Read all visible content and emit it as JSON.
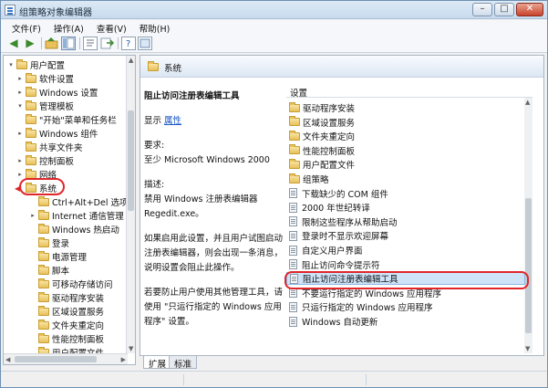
{
  "window": {
    "title": "组策略对象编辑器",
    "controls": {
      "minimize": "–",
      "maximize": "□",
      "close": "✕"
    }
  },
  "menu": [
    "文件(F)",
    "操作(A)",
    "查看(V)",
    "帮助(H)"
  ],
  "toolbar": {
    "icons": [
      "back-arrow-icon",
      "forward-arrow-icon",
      "up-folder-icon",
      "show-tree-icon",
      "properties-icon",
      "export-icon",
      "help-icon",
      "view-icon"
    ]
  },
  "tree": {
    "items": [
      {
        "label": "用户配置",
        "level": 0,
        "expander": "▾"
      },
      {
        "label": "软件设置",
        "level": 1,
        "expander": "▸"
      },
      {
        "label": "Windows 设置",
        "level": 1,
        "expander": "▸"
      },
      {
        "label": "管理模板",
        "level": 1,
        "expander": "▾"
      },
      {
        "label": "\"开始\"菜单和任务栏",
        "level": 2,
        "expander": ""
      },
      {
        "label": "Windows 组件",
        "level": 2,
        "expander": "▸"
      },
      {
        "label": "共享文件夹",
        "level": 2,
        "expander": ""
      },
      {
        "label": "控制面板",
        "level": 2,
        "expander": "▸"
      },
      {
        "label": "网络",
        "level": 2,
        "expander": "▸"
      },
      {
        "label": "系统",
        "level": 2,
        "expander": "▾",
        "selected": true
      },
      {
        "label": "Ctrl+Alt+Del 选项",
        "level": 3,
        "expander": ""
      },
      {
        "label": "Internet 通信管理",
        "level": 3,
        "expander": "▸"
      },
      {
        "label": "Windows 热启动",
        "level": 3,
        "expander": ""
      },
      {
        "label": "登录",
        "level": 3,
        "expander": ""
      },
      {
        "label": "电源管理",
        "level": 3,
        "expander": ""
      },
      {
        "label": "脚本",
        "level": 3,
        "expander": ""
      },
      {
        "label": "可移动存储访问",
        "level": 3,
        "expander": ""
      },
      {
        "label": "驱动程序安装",
        "level": 3,
        "expander": ""
      },
      {
        "label": "区域设置服务",
        "level": 3,
        "expander": ""
      },
      {
        "label": "文件夹重定向",
        "level": 3,
        "expander": ""
      },
      {
        "label": "性能控制面板",
        "level": 3,
        "expander": ""
      },
      {
        "label": "用户配置文件",
        "level": 3,
        "expander": ""
      }
    ]
  },
  "details": {
    "header": "系统",
    "policy_title": "阻止访问注册表编辑工具",
    "display_label": "显示",
    "properties_link": "属性",
    "requirements_label": "要求:",
    "requirements_value": "至少 Microsoft Windows 2000",
    "description_label": "描述:",
    "description_lines": [
      "禁用 Windows 注册表编辑器",
      "Regedit.exe。"
    ],
    "para2_lines": [
      "如果启用此设置，并且用户试图启动",
      "注册表编辑器，则会出现一条消息，",
      "说明设置会阻止此操作。"
    ],
    "para3_lines": [
      "若要防止用户使用其他管理工具，请",
      "使用 \"只运行指定的 Windows 应用",
      "程序\" 设置。"
    ]
  },
  "settings": {
    "column_header": "设置",
    "folders": [
      "驱动程序安装",
      "区域设置服务",
      "文件夹重定向",
      "性能控制面板",
      "用户配置文件",
      "组策略"
    ],
    "policies": [
      {
        "label": "下载缺少的 COM 组件"
      },
      {
        "label": "2000 年世纪转译"
      },
      {
        "label": "限制这些程序从帮助启动"
      },
      {
        "label": "登录时不显示欢迎屏幕"
      },
      {
        "label": "自定义用户界面"
      },
      {
        "label": "阻止访问命令提示符"
      },
      {
        "label": "阻止访问注册表编辑工具",
        "selected": true
      },
      {
        "label": "不要运行指定的 Windows 应用程序"
      },
      {
        "label": "只运行指定的 Windows 应用程序"
      },
      {
        "label": "Windows 自动更新"
      }
    ]
  },
  "tabs": [
    "扩展",
    "标准"
  ],
  "annotation_color": "#e0262b"
}
